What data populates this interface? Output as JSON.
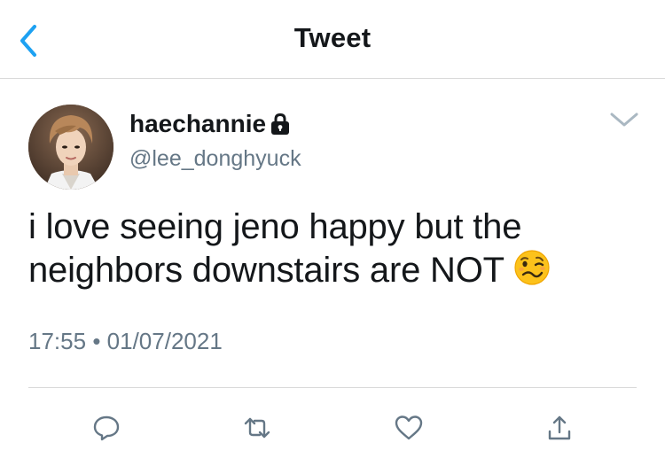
{
  "header": {
    "title": "Tweet",
    "back_icon": "chevron-left-icon",
    "accent_color": "#1da1f2"
  },
  "author": {
    "display_name": "haechannie",
    "handle": "@lee_donghyuck",
    "protected_icon": "lock-icon"
  },
  "tweet": {
    "text_line_1": "i love seeing jeno happy but the",
    "text_line_2": "neighbors downstairs are NOT",
    "emoji": "woozy-face-emoji",
    "time": "17:55",
    "separator": "•",
    "date": "01/07/2021"
  },
  "actions": {
    "icons": [
      "reply-icon",
      "retweet-icon",
      "like-icon",
      "share-icon"
    ],
    "icon_color": "#657786"
  },
  "colors": {
    "text_primary": "#14171a",
    "text_secondary": "#657786",
    "divider": "#d9d9d9"
  }
}
